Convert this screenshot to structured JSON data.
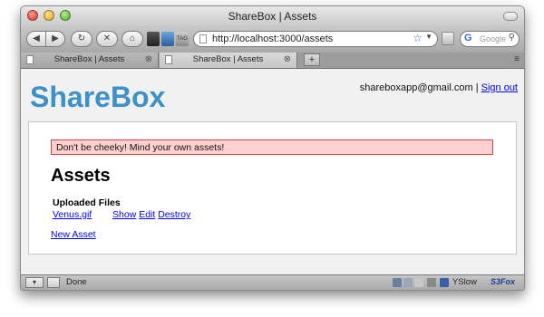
{
  "window": {
    "title": "ShareBox | Assets"
  },
  "toolbar": {
    "url": "http://localhost:3000/assets",
    "search_placeholder": "Google",
    "ext3_label": "TAG"
  },
  "tabs": [
    {
      "label": "ShareBox | Assets",
      "active": false
    },
    {
      "label": "ShareBox | Assets",
      "active": true
    }
  ],
  "page": {
    "logo": "ShareBox",
    "user_email": "shareboxapp@gmail.com",
    "separator": "|",
    "sign_out": "Sign out",
    "flash": "Don't be cheeky! Mind your own assets!",
    "heading": "Assets",
    "files_header": "Uploaded Files",
    "files": [
      {
        "name": "Venus.gif",
        "show": "Show",
        "edit": "Edit",
        "destroy": "Destroy"
      }
    ],
    "new_asset": "New Asset"
  },
  "statusbar": {
    "status": "Done",
    "yslow": "YSlow",
    "s3fox": "S3Fox"
  },
  "colors": {
    "logo": "#3d90c8",
    "flash_bg": "#ffd0d0",
    "flash_border": "#cc4444",
    "link": "#0000ee"
  },
  "icons": {
    "back": "back-arrow-icon",
    "forward": "forward-arrow-icon",
    "reload": "reload-icon",
    "stop": "stop-icon",
    "home": "home-icon",
    "bookmark": "star-icon",
    "search": "magnifier-icon"
  }
}
